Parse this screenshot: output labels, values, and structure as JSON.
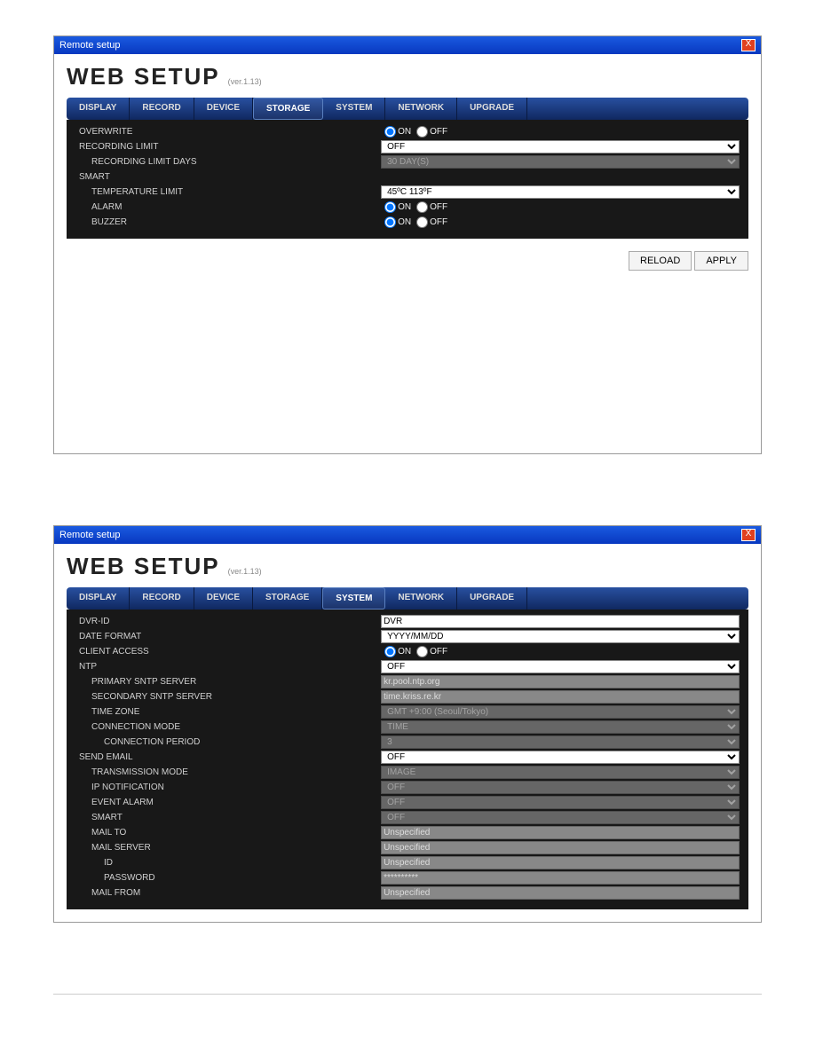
{
  "win1": {
    "title": "Remote setup",
    "close": "X",
    "header": "WEB SETUP",
    "version": "(ver.1.13)",
    "tabs": [
      "DISPLAY",
      "RECORD",
      "DEVICE",
      "STORAGE",
      "SYSTEM",
      "NETWORK",
      "UPGRADE"
    ],
    "activeTab": "STORAGE",
    "labels": {
      "overwrite": "OVERWRITE",
      "recLimit": "RECORDING LIMIT",
      "recLimitDays": "RECORDING LIMIT DAYS",
      "smart": "SMART",
      "tempLimit": "TEMPERATURE LIMIT",
      "alarm": "ALARM",
      "buzzer": "BUZZER"
    },
    "values": {
      "on": "ON",
      "off": "OFF",
      "recLimit": "OFF",
      "recLimitDays": "30 DAY(S)",
      "tempLimit": "45ºC 113ºF"
    },
    "buttons": {
      "reload": "RELOAD",
      "apply": "APPLY"
    }
  },
  "win2": {
    "title": "Remote setup",
    "close": "X",
    "header": "WEB SETUP",
    "version": "(ver.1.13)",
    "tabs": [
      "DISPLAY",
      "RECORD",
      "DEVICE",
      "STORAGE",
      "SYSTEM",
      "NETWORK",
      "UPGRADE"
    ],
    "activeTab": "SYSTEM",
    "labels": {
      "dvrid": "DVR-ID",
      "dateFormat": "DATE FORMAT",
      "clientAccess": "CLIENT ACCESS",
      "ntp": "NTP",
      "primarySntp": "PRIMARY SNTP SERVER",
      "secondarySntp": "SECONDARY SNTP SERVER",
      "timeZone": "TIME ZONE",
      "connMode": "CONNECTION MODE",
      "connPeriod": "CONNECTION PERIOD",
      "sendEmail": "SEND EMAIL",
      "transMode": "TRANSMISSION MODE",
      "ipNotif": "IP NOTIFICATION",
      "eventAlarm": "EVENT ALARM",
      "smart": "SMART",
      "mailTo": "MAIL TO",
      "mailServer": "MAIL SERVER",
      "id": "ID",
      "password": "PASSWORD",
      "mailFrom": "MAIL FROM"
    },
    "values": {
      "on": "ON",
      "off": "OFF",
      "dvrid": "DVR",
      "dateFormat": "YYYY/MM/DD",
      "ntp": "OFF",
      "primarySntp": "kr.pool.ntp.org",
      "secondarySntp": "time.kriss.re.kr",
      "timeZone": "GMT +9:00 (Seoul/Tokyo)",
      "connMode": "TIME",
      "connPeriod": "3",
      "sendEmail": "OFF",
      "transMode": "IMAGE",
      "ipNotif": "OFF",
      "eventAlarm": "OFF",
      "smart": "OFF",
      "mailTo": "Unspecified",
      "mailServer": "Unspecified",
      "id": "Unspecified",
      "password": "**********",
      "mailFrom": "Unspecified"
    }
  }
}
